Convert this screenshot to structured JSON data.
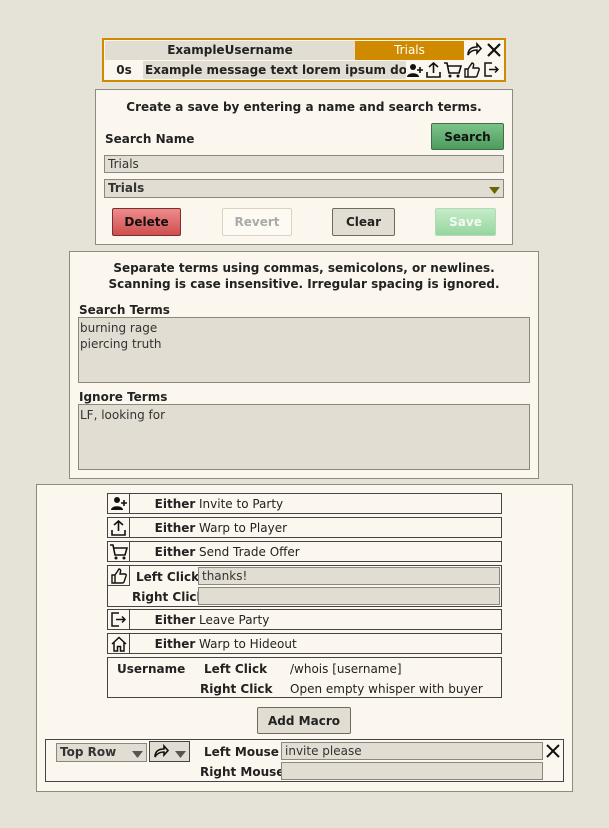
{
  "overlay": {
    "username": "ExampleUsername",
    "tab": "Trials",
    "time": "0s",
    "message": "Example message text lorem ipsum dolor sit a"
  },
  "save_panel": {
    "instructions": "Create a save by entering a name and search terms.",
    "search_name_label": "Search Name",
    "search_button": "Search",
    "name_value": "Trials",
    "dropdown_value": "Trials",
    "delete_button": "Delete",
    "revert_button": "Revert",
    "clear_button": "Clear",
    "save_button": "Save"
  },
  "terms_panel": {
    "line1": "Separate terms using commas, semicolons, or newlines.",
    "line2": "Scanning is case insensitive. Irregular spacing is ignored.",
    "search_terms_label": "Search Terms",
    "search_terms": [
      "burning rage",
      "piercing truth"
    ],
    "ignore_terms_label": "Ignore Terms",
    "ignore_terms": [
      "LF, looking for"
    ]
  },
  "macros": {
    "rows": [
      {
        "icon": "invite-icon",
        "mode": "Either",
        "action": "Invite to Party"
      },
      {
        "icon": "warp-icon",
        "mode": "Either",
        "action": "Warp to Player"
      },
      {
        "icon": "cart-icon",
        "mode": "Either",
        "action": "Send Trade Offer"
      },
      {
        "icon": "thumbs-up-icon",
        "left_label": "Left Click",
        "left_value": "thanks!",
        "right_label": "Right Click",
        "right_value": ""
      },
      {
        "icon": "leave-icon",
        "mode": "Either",
        "action": "Leave Party"
      },
      {
        "icon": "home-icon",
        "mode": "Either",
        "action": "Warp to Hideout"
      }
    ],
    "username_row": {
      "label": "Username",
      "left_label": "Left Click",
      "left_value": "/whois [username]",
      "right_label": "Right Click",
      "right_value": "Open empty whisper with buyer"
    },
    "add_button": "Add Macro",
    "custom": {
      "position": "Top Row",
      "left_mouse_label": "Left Mouse",
      "left_mouse_value": "invite please",
      "right_mouse_label": "Right Mouse",
      "right_mouse_value": ""
    }
  },
  "colors": {
    "accent": "#d08a00",
    "background": "#e5e2d8",
    "panel": "#fcf7ee",
    "search_green": "#5aa86c",
    "delete_red": "#d65a5a"
  }
}
